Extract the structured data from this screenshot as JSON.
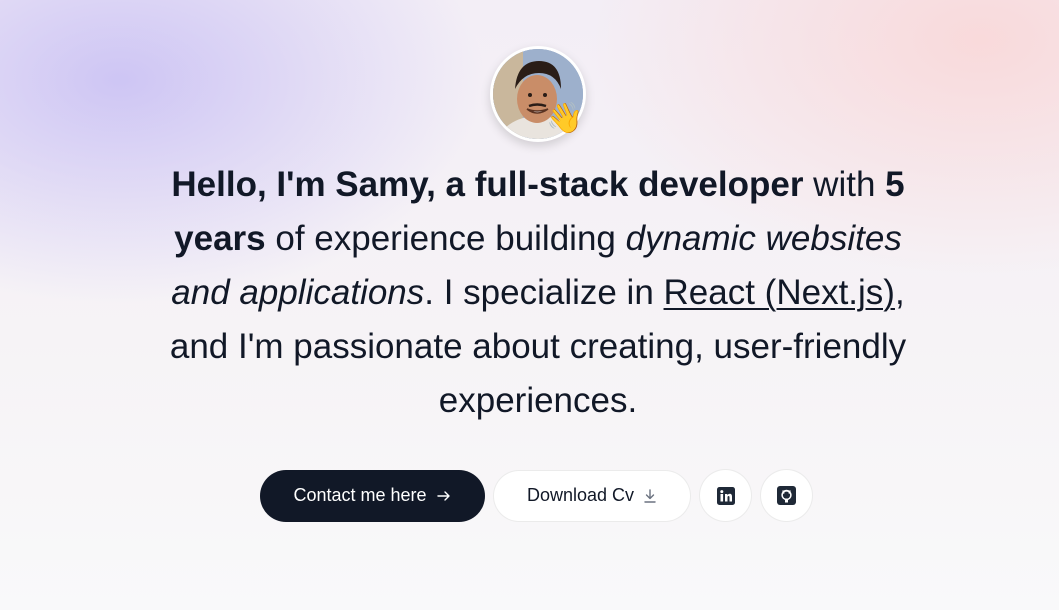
{
  "hero": {
    "intro": {
      "p1_bold": "Hello, I'm Samy, a full-stack developer",
      "p2": " with ",
      "p3_bold": "5 years",
      "p4": " of experience building ",
      "p5_italic": "dynamic websites and applications",
      "p6": ". I specialize in ",
      "p7_underline": "React (Next.js)",
      "p8": ", and I'm passionate about creating, user-friendly experiences."
    },
    "avatar_emoji": "👋"
  },
  "actions": {
    "contact_label": "Contact me here",
    "contact_icon": "arrow-right-icon",
    "download_label": "Download Cv",
    "download_icon": "download-icon",
    "linkedin_icon": "linkedin-icon",
    "github_icon": "github-icon"
  },
  "colors": {
    "primary_button": "#111827",
    "text": "#111827",
    "background_left": "#c7bef4",
    "background_right": "#fad6d6"
  }
}
